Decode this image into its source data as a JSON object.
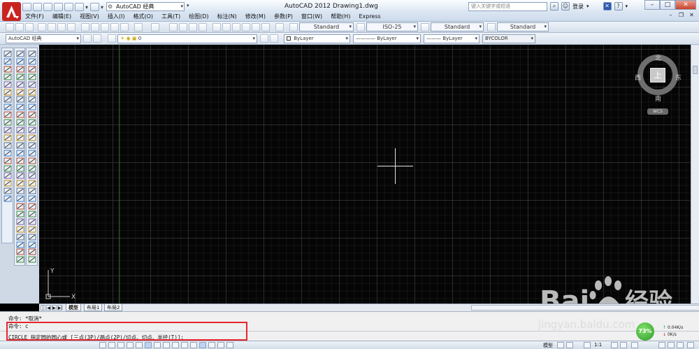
{
  "titlebar": {
    "workspace": "AutoCAD 经典",
    "app_title": "AutoCAD 2012",
    "doc_title": "Drawing1.dwg",
    "help_placeholder": "键入关键字或短语",
    "login_label": "登录"
  },
  "menus": [
    "文件(F)",
    "编辑(E)",
    "视图(V)",
    "插入(I)",
    "格式(O)",
    "工具(T)",
    "绘图(D)",
    "标注(N)",
    "修改(M)",
    "参数(P)",
    "窗口(W)",
    "帮助(H)",
    "Express"
  ],
  "styles_toolbar": {
    "text_style": "Standard",
    "dim_style": "ISO-25",
    "table_style": "Standard",
    "mleader_style": "Standard"
  },
  "workspace_toolbar": {
    "workspace": "AutoCAD 经典",
    "layer": "0",
    "color": "ByLayer",
    "linetype": "ByLayer",
    "lineweight": "ByLayer",
    "plotstyle": "BYCOLOR"
  },
  "viewcube": {
    "north": "北",
    "south": "南",
    "east": "东",
    "west": "西",
    "face": "上",
    "wcs": "WCS"
  },
  "ucs": {
    "x_label": "X",
    "y_label": "Y"
  },
  "layout_tabs": [
    "模型",
    "布局1",
    "布局2"
  ],
  "command_history": [
    "命令: *取消*",
    "命令: c"
  ],
  "command_prompt": "CIRCLE 指定圆的圆心或 [三点(3P)/两点(2P)/切点、切点、半径(T)]:",
  "statusbar": {
    "model_label": "模型",
    "annotation_scale": "1:1"
  },
  "net_widget": {
    "percent": "73%",
    "upload": "0.04K/s",
    "download": "0K/s"
  },
  "watermark": {
    "domain": "jingyan.baidu.com"
  },
  "colors": {
    "canvas_bg": "#050505",
    "highlight": "#e6262e",
    "logo_red": "#c8241f"
  }
}
